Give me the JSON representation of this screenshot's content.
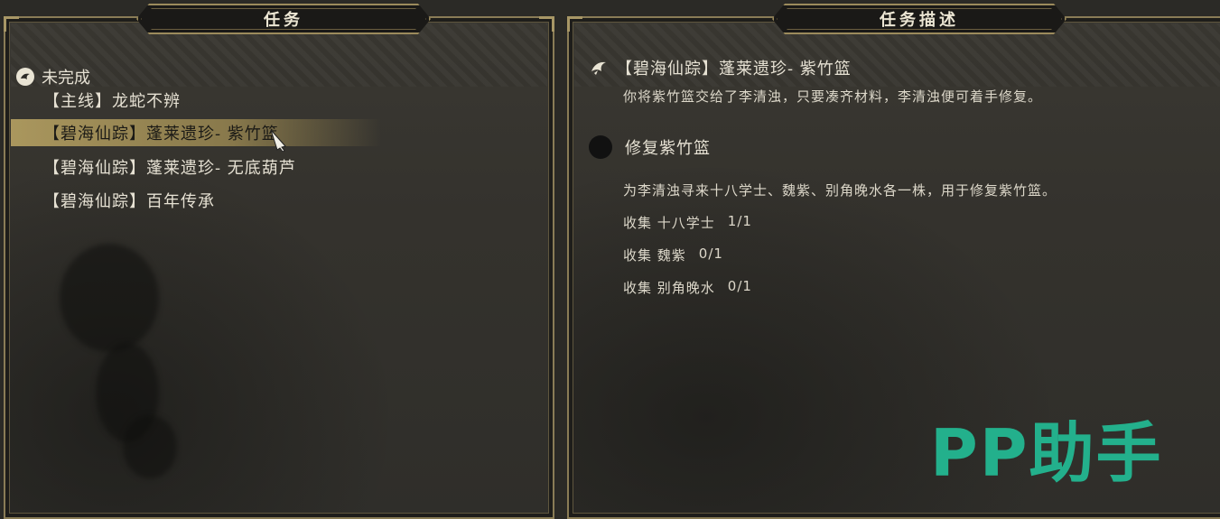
{
  "left_panel": {
    "title": "任务",
    "category": {
      "icon": "bird-icon",
      "label": "未完成"
    },
    "quests": [
      {
        "label": "【主线】龙蛇不辨",
        "selected": false
      },
      {
        "label": "【碧海仙踪】蓬莱遗珍- 紫竹篮",
        "selected": true
      },
      {
        "label": "【碧海仙踪】蓬莱遗珍- 无底葫芦",
        "selected": false
      },
      {
        "label": "【碧海仙踪】百年传承",
        "selected": false
      }
    ]
  },
  "right_panel": {
    "title": "任务描述",
    "quest_title": "【碧海仙踪】蓬莱遗珍- 紫竹篮",
    "quest_description": "你将紫竹篮交给了李清浊，只要凑齐材料，李清浊便可着手修复。",
    "sub_title": "修复紫竹篮",
    "sub_description": "为李清浊寻来十八学士、魏紫、别角晚水各一株，用于修复紫竹篮。",
    "objectives": [
      {
        "label": "收集 十八学士",
        "progress": "1/1"
      },
      {
        "label": "收集 魏紫",
        "progress": "0/1"
      },
      {
        "label": "收集 别角晚水",
        "progress": "0/1"
      }
    ]
  },
  "watermark": "PP助手",
  "colors": {
    "selected_highlight": "#b09c60",
    "frame_gold": "#8a7c56",
    "watermark_green": "#23b08c"
  }
}
